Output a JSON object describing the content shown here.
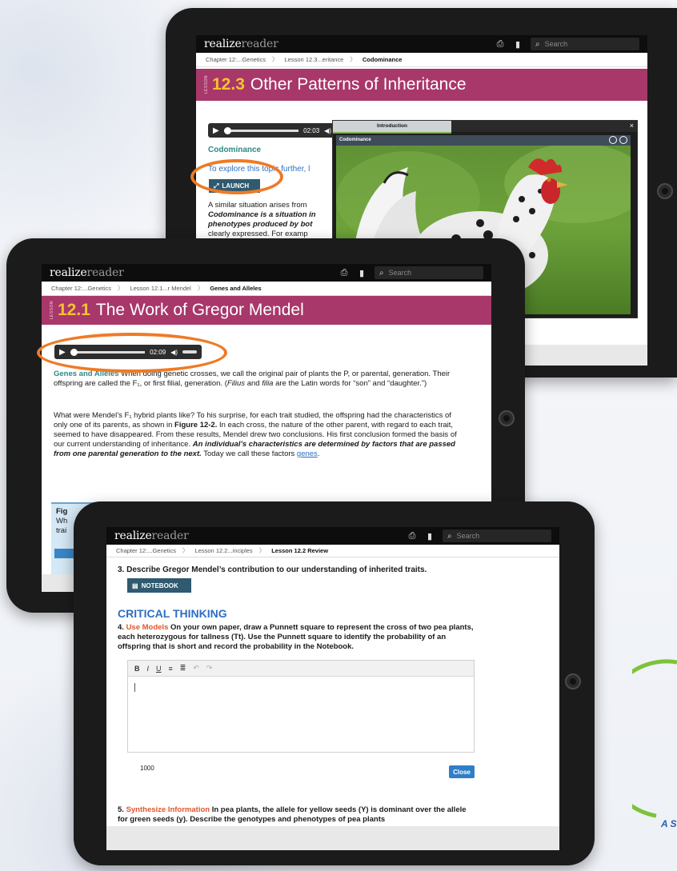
{
  "tablet1": {
    "brand_main": "realize",
    "brand_sub": "reader",
    "search_placeholder": "Search",
    "crumbs": [
      "Chapter 12:...Genetics",
      "Lesson 12.3...eritance",
      "Codominance"
    ],
    "lesson_tag": "LESSON",
    "lesson_num": "12.3",
    "lesson_title": "Other Patterns of Inheritance",
    "audio_time": "02:03",
    "section_heading": "Codominance",
    "explore_text": "To explore this topic further, l",
    "launch_label": "LAUNCH",
    "body_lines": [
      "A similar situation arises from",
      "Codominance is a situation in",
      "phenotypes produced by bot",
      "clearly expressed. For examp"
    ],
    "popup": {
      "tab_label": "Introduction",
      "close": "×",
      "inner_title": "Codominance"
    }
  },
  "tablet2": {
    "brand_main": "realize",
    "brand_sub": "reader",
    "search_placeholder": "Search",
    "crumbs": [
      "Chapter 12:...Genetics",
      "Lesson 12.1...r Mendel",
      "Genes and Alleles"
    ],
    "lesson_tag": "LESSON",
    "lesson_num": "12.1",
    "lesson_title": "The Work of Gregor Mendel",
    "audio_time": "02:09",
    "para1": {
      "heading": "Genes and Alleles",
      "text1": " When doing genetic crosses, we call the original pair of plants the P, or parental, generation. Their offspring are called the F₁, or first filial, generation. (",
      "filius": "Filius",
      "text2": " and ",
      "filia": "filia",
      "text3": " are the Latin words for “son” and “daughter.”)"
    },
    "para2": {
      "text1": "What were Mendel’s F₁ hybrid plants like? To his surprise, for each trait studied, the offspring had the characteristics of only one of its parents, as shown in ",
      "figure": "Figure 12-2.",
      "text2": " In each cross, the nature of the other parent, with regard to each trait, seemed to have disappeared. From these results, Mendel drew two conclusions. His first conclusion formed the basis of our current understanding of inheritance. ",
      "bold": "An individual’s characteristics are determined by factors that are passed from one parental generation to the next.",
      "text3": " Today we call these factors ",
      "genes": "genes",
      "text4": "."
    },
    "figure_box": {
      "l1": "Fig",
      "l2": "Wh",
      "l3": "trai"
    }
  },
  "tablet3": {
    "brand_main": "realize",
    "brand_sub": "reader",
    "search_placeholder": "Search",
    "crumbs": [
      "Chapter 12:...Genetics",
      "Lesson 12.2...inciples",
      "Lesson 12.2 Review"
    ],
    "q3": "3. Describe Gregor Mendel’s contribution to our understanding of inherited traits.",
    "notebook_label": "NOTEBOOK",
    "critical_heading": "CRITICAL THINKING",
    "q4_num": "4. ",
    "q4_label": "Use Models",
    "q4_text": " On your own paper, draw a Punnett square to represent the cross of two pea plants, each heterozygous for tallness (Tt). Use the Punnett square to identify the probability of an offspring that is short and record the probability in the Notebook.",
    "editor_tools": [
      "B",
      "I",
      "U",
      "≡",
      "≣",
      "↶",
      "↷"
    ],
    "char_count": "1000",
    "close_label": "Close",
    "q5_num": "5. ",
    "q5_label": "Synthesize Information",
    "q5_text": " In pea plants, the allele for yellow seeds (Y) is dominant over the allele for green seeds (y). Describe the genotypes and phenotypes of pea plants"
  },
  "logo_text": "A S",
  "colors": {
    "lesson_bar": "#a8376a",
    "lesson_num": "#f5c331",
    "highlight_ring": "#ef7a24",
    "teal": "#2a8a86",
    "link": "#2d6fc1",
    "btn_dark": "#2f5a70",
    "close_btn": "#2f7ec8"
  }
}
